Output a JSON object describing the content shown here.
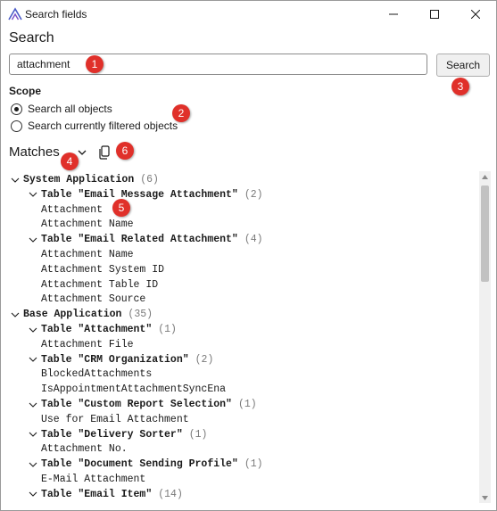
{
  "window": {
    "title": "Search fields"
  },
  "search": {
    "heading": "Search",
    "value": "attachment",
    "button_label": "Search"
  },
  "scope": {
    "label": "Scope",
    "options": [
      "Search all objects",
      "Search currently filtered objects"
    ],
    "selected": "Search all objects"
  },
  "matches": {
    "label": "Matches"
  },
  "tree": [
    {
      "level": 0,
      "text": "System Application",
      "count": "(6)",
      "bold": true,
      "expandable": true
    },
    {
      "level": 1,
      "text": "Table \"Email Message Attachment\"",
      "count": "(2)",
      "bold": true,
      "expandable": true
    },
    {
      "level": 2,
      "text": "Attachment"
    },
    {
      "level": 2,
      "text": "Attachment Name"
    },
    {
      "level": 1,
      "text": "Table \"Email Related Attachment\"",
      "count": "(4)",
      "bold": true,
      "expandable": true
    },
    {
      "level": 2,
      "text": "Attachment Name"
    },
    {
      "level": 2,
      "text": "Attachment System ID"
    },
    {
      "level": 2,
      "text": "Attachment Table ID"
    },
    {
      "level": 2,
      "text": "Attachment Source"
    },
    {
      "level": 0,
      "text": "Base Application",
      "count": "(35)",
      "bold": true,
      "expandable": true
    },
    {
      "level": 1,
      "text": "Table \"Attachment\"",
      "count": "(1)",
      "bold": true,
      "expandable": true
    },
    {
      "level": 2,
      "text": "Attachment File"
    },
    {
      "level": 1,
      "text": "Table \"CRM Organization\"",
      "count": "(2)",
      "bold": true,
      "expandable": true
    },
    {
      "level": 2,
      "text": "BlockedAttachments"
    },
    {
      "level": 2,
      "text": "IsAppointmentAttachmentSyncEna"
    },
    {
      "level": 1,
      "text": "Table \"Custom Report Selection\"",
      "count": "(1)",
      "bold": true,
      "expandable": true
    },
    {
      "level": 2,
      "text": "Use for Email Attachment"
    },
    {
      "level": 1,
      "text": "Table \"Delivery Sorter\"",
      "count": "(1)",
      "bold": true,
      "expandable": true
    },
    {
      "level": 2,
      "text": "Attachment No."
    },
    {
      "level": 1,
      "text": "Table \"Document Sending Profile\"",
      "count": "(1)",
      "bold": true,
      "expandable": true
    },
    {
      "level": 2,
      "text": "E-Mail Attachment"
    },
    {
      "level": 1,
      "text": "Table \"Email Item\"",
      "count": "(14)",
      "bold": true,
      "expandable": true
    }
  ],
  "callouts": [
    "1",
    "2",
    "3",
    "4",
    "5",
    "6"
  ],
  "colors": {
    "callout": "#e0302a",
    "accent": "#5b6bd5"
  }
}
